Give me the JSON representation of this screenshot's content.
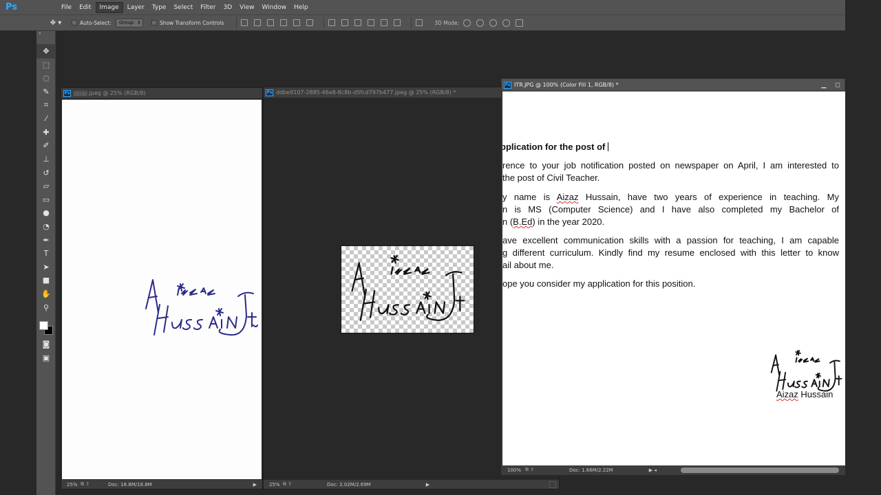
{
  "menubar": {
    "logo": "Ps",
    "items": [
      "File",
      "Edit",
      "Image",
      "Layer",
      "Type",
      "Select",
      "Filter",
      "3D",
      "View",
      "Window",
      "Help"
    ],
    "active": "Image"
  },
  "options": {
    "auto_select_label": "Auto-Select:",
    "auto_select_value": "Group",
    "transform_label": "Show Transform Controls",
    "mode_label": "3D Mode:"
  },
  "docs": [
    {
      "title": "jjjjjjjjj.jpeg @ 25% (RGB/8)",
      "zoom": "25%",
      "doc_size": "Doc: 18.8M/18.8M"
    },
    {
      "title": "ddbe9107-2885-46e8-8c8b-d5fcd797b477.jpeg @ 25% (RGB/8) *",
      "zoom": "25%",
      "doc_size": "Doc: 2.02M/2.69M"
    },
    {
      "title": "ITR.JPG @ 100% (Color Fill 1, RGB/8) *",
      "zoom": "100%",
      "doc_size": "Doc: 1.66M/2.22M"
    }
  ],
  "letter": {
    "subject": "pplication for the post of",
    "p1": [
      "rence to your job notification posted on newspaper on April, I am interested to",
      "the post of Civil Teacher."
    ],
    "p2_a": "y name is ",
    "p2_name1": "Aizaz",
    "p2_b": " Hussain, have two years of experience in teaching. My",
    "p2_l2": "n is MS (Computer Science) and I have also completed my Bachelor of",
    "p2_l3a": "n (",
    "p2_bed": "B.Ed",
    "p2_l3b": ") in the year 2020.",
    "p3": [
      "ave excellent communication skills with a passion for teaching, I am capable",
      "g different curriculum. Kindly find my resume enclosed with this letter to know",
      "ail about me."
    ],
    "p4": "ope you consider my application for this position.",
    "sig_first": "Aizaz",
    "sig_last": " Hussain"
  },
  "colors": {
    "signature_blue": "#2a2a8a",
    "signature_black": "#111111",
    "ui_panel": "#535353",
    "workspace": "#282828",
    "ps_accent": "#31a8ff"
  }
}
